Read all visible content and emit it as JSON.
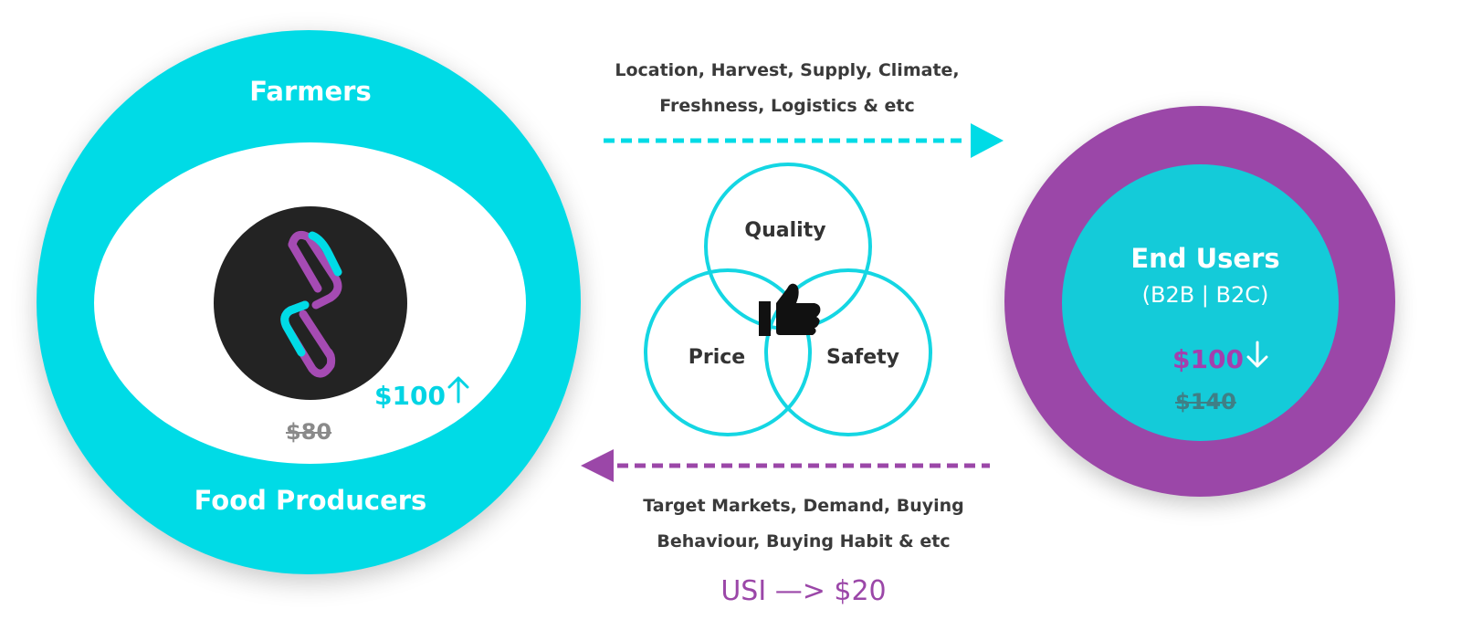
{
  "left": {
    "top_label": "Farmers",
    "bottom_label": "Food Producers",
    "price_new": "$100",
    "price_old": "$80"
  },
  "right": {
    "title": "End Users",
    "subtitle": "(B2B | B2C)",
    "price_new": "$100",
    "price_old": "$140"
  },
  "flows": {
    "top_line1": "Location, Harvest, Supply, Climate,",
    "top_line2": "Freshness, Logistics & etc",
    "bottom_line1": "Target Markets, Demand, Buying",
    "bottom_line2": "Behaviour, Buying Habit & etc"
  },
  "venn": {
    "quality": "Quality",
    "price": "Price",
    "safety": "Safety"
  },
  "footer": {
    "usi": "USI —> $20"
  },
  "colors": {
    "cyan": "#00dbe6",
    "purple": "#9b47a8",
    "dark": "#232323"
  },
  "icons": [
    "logo-mark-icon",
    "arrow-up-icon",
    "arrow-down-icon",
    "thumbs-up-icon",
    "arrow-right-icon",
    "arrow-left-icon"
  ]
}
